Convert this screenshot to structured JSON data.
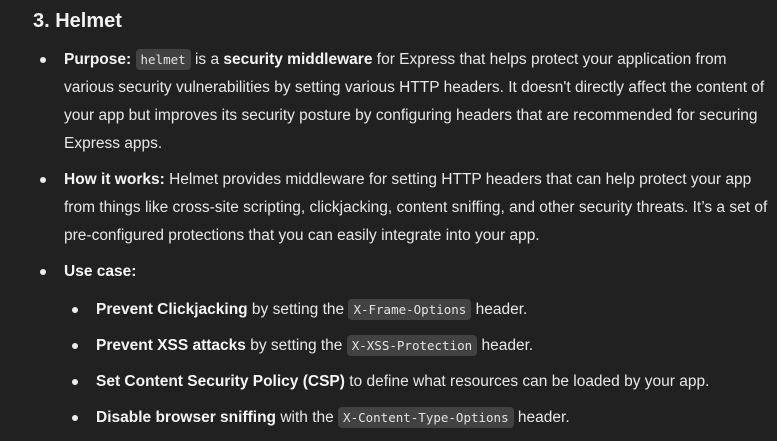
{
  "heading": "3. Helmet",
  "items": {
    "purpose": {
      "label": "Purpose:",
      "code": "helmet",
      "text_a": " is a ",
      "bold": "security middleware",
      "text_b": " for Express that helps protect your application from various security vulnerabilities by setting various HTTP headers. It doesn't directly affect the content of your app but improves its security posture by configuring headers that are recommended for securing Express apps."
    },
    "how": {
      "label": "How it works:",
      "text": " Helmet provides middleware for setting HTTP headers that can help protect your app from things like cross-site scripting, clickjacking, content sniffing, and other security threats. It’s a set of pre-configured protections that you can easily integrate into your app."
    },
    "use_case": {
      "label": "Use case:",
      "subitems": [
        {
          "bold": "Prevent Clickjacking",
          "before": " by setting the ",
          "code": "X-Frame-Options",
          "after": " header."
        },
        {
          "bold": "Prevent XSS attacks",
          "before": " by setting the ",
          "code": "X-XSS-Protection",
          "after": " header."
        },
        {
          "bold": "Set Content Security Policy (CSP)",
          "before": " to define what resources can be loaded by your app.",
          "code": "",
          "after": ""
        },
        {
          "bold": "Disable browser sniffing",
          "before": " with the ",
          "code": "X-Content-Type-Options",
          "after": " header."
        }
      ]
    }
  }
}
